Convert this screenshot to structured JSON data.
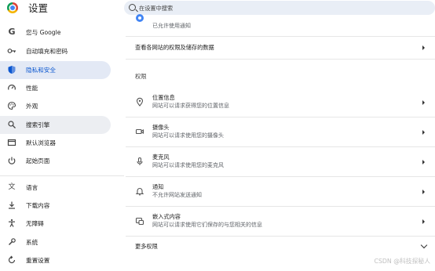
{
  "app": {
    "title": "设置"
  },
  "search": {
    "placeholder": "在设置中搜索"
  },
  "sidebar": {
    "items": [
      {
        "label": "您与 Google",
        "icon": "google-icon"
      },
      {
        "label": "自动填充和密码",
        "icon": "key-icon"
      },
      {
        "label": "隐私和安全",
        "icon": "shield-icon",
        "active": true
      },
      {
        "label": "性能",
        "icon": "speedometer-icon"
      },
      {
        "label": "外观",
        "icon": "palette-icon"
      },
      {
        "label": "搜索引擎",
        "icon": "search-icon",
        "hover": true
      },
      {
        "label": "默认浏览器",
        "icon": "browser-icon"
      },
      {
        "label": "起始页面",
        "icon": "power-icon"
      },
      {
        "label": "语言",
        "icon": "translate-icon"
      },
      {
        "label": "下载内容",
        "icon": "download-icon"
      },
      {
        "label": "无障碍",
        "icon": "accessibility-icon"
      },
      {
        "label": "系统",
        "icon": "wrench-icon"
      },
      {
        "label": "重置设置",
        "icon": "reset-icon"
      }
    ]
  },
  "main": {
    "top_row": {
      "subtitle": "已允许使用通知"
    },
    "site_data_row": {
      "label": "查看各网站的权限及储存的数据"
    },
    "permissions_heading": "权限",
    "permissions": [
      {
        "title": "位置信息",
        "subtitle": "网站可以请求获得您的位置信息",
        "icon": "location-icon"
      },
      {
        "title": "摄像头",
        "subtitle": "网站可以请求使用您的摄像头",
        "icon": "camera-icon"
      },
      {
        "title": "麦克风",
        "subtitle": "网站可以请求使用您的麦克风",
        "icon": "microphone-icon"
      },
      {
        "title": "通知",
        "subtitle": "不允许网站发送通知",
        "icon": "bell-icon"
      },
      {
        "title": "嵌入式内容",
        "subtitle": "网站可以请求使用它们保存的与您相关的信息",
        "icon": "embedded-content-icon"
      }
    ],
    "more_permissions": "更多权限"
  },
  "watermark": "CSDN @科技探秘人",
  "colors": {
    "accent": "#0b57d0",
    "active_bg": "#e3e9f5",
    "search_bg": "#e9eef6"
  }
}
